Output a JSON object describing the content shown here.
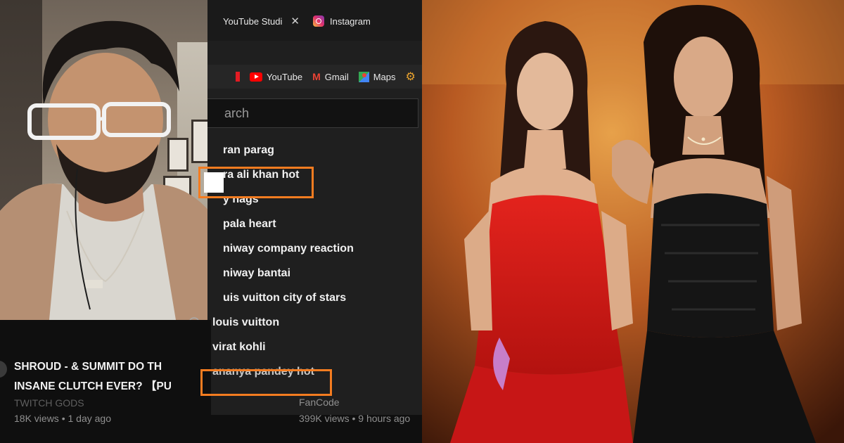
{
  "browser": {
    "tabs": [
      {
        "label": "YouTube Studi",
        "icon": "youtube-studio-icon"
      },
      {
        "label": "Instagram",
        "icon": "instagram-icon"
      }
    ],
    "bookmarks": [
      {
        "label": "YouTube",
        "icon": "youtube-icon"
      },
      {
        "label": "Gmail",
        "icon": "gmail-icon"
      },
      {
        "label": "Maps",
        "icon": "maps-icon"
      }
    ],
    "search_placeholder": "arch"
  },
  "suggestions": [
    {
      "text": "ran parag",
      "history": false
    },
    {
      "text": "ra ali khan hot",
      "history": false,
      "highlighted": true
    },
    {
      "text": "y nags",
      "history": false
    },
    {
      "text": "pala heart",
      "history": false
    },
    {
      "text": "niway company reaction",
      "history": false
    },
    {
      "text": "niway bantai",
      "history": false
    },
    {
      "text": "uis vuitton city of stars",
      "history": false
    },
    {
      "text": "louis vuitton",
      "history": true
    },
    {
      "text": "virat kohli",
      "history": true
    },
    {
      "text": "ananya pandey hot",
      "history": true,
      "highlighted": true
    }
  ],
  "video_left": {
    "title_line1": "SHROUD - & SUMMIT DO TH",
    "title_line2": "INSANE CLUTCH EVER? 【PU",
    "channel": "TWITCH GODS",
    "meta": "18K views • 1 day ago"
  },
  "video_right": {
    "channel": "FanCode",
    "meta": "399K views • 9 hours ago"
  },
  "colors": {
    "highlight": "#f47c20",
    "youtube_red": "#ff0000",
    "dress_red": "#d91a1a",
    "background_dark": "#0f0f0f"
  }
}
